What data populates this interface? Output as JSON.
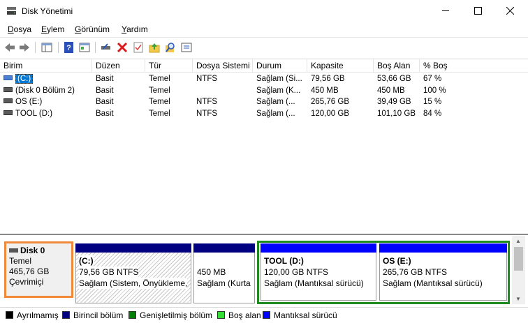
{
  "window": {
    "title": "Disk Yönetimi"
  },
  "menu": [
    {
      "key": "D",
      "rest": "osya"
    },
    {
      "key": "E",
      "rest": "ylem"
    },
    {
      "key": "G",
      "rest": "örünüm"
    },
    {
      "key": "Y",
      "rest": "ardım"
    }
  ],
  "columns": [
    "Birim",
    "Düzen",
    "Tür",
    "Dosya Sistemi",
    "Durum",
    "Kapasite",
    "Boş Alan",
    "% Boş"
  ],
  "volumes": [
    {
      "name": "(C:)",
      "layout": "Basit",
      "type": "Temel",
      "fs": "NTFS",
      "status": "Sağlam (Si...",
      "capacity": "79,56 GB",
      "free": "53,66 GB",
      "pct": "67 %",
      "icon": "volume-blue-icon"
    },
    {
      "name": "(Disk 0 Bölüm 2)",
      "layout": "Basit",
      "type": "Temel",
      "fs": "",
      "status": "Sağlam (K...",
      "capacity": "450 MB",
      "free": "450 MB",
      "pct": "100 %",
      "icon": "volume-icon"
    },
    {
      "name": "OS (E:)",
      "layout": "Basit",
      "type": "Temel",
      "fs": "NTFS",
      "status": "Sağlam (...",
      "capacity": "265,76 GB",
      "free": "39,49 GB",
      "pct": "15 %",
      "icon": "volume-icon"
    },
    {
      "name": "TOOL (D:)",
      "layout": "Basit",
      "type": "Temel",
      "fs": "NTFS",
      "status": "Sağlam (...",
      "capacity": "120,00 GB",
      "free": "101,10 GB",
      "pct": "84 %",
      "icon": "volume-icon"
    }
  ],
  "disk": {
    "name": "Disk 0",
    "type": "Temel",
    "size": "465,76 GB",
    "state": "Çevrimiçi"
  },
  "partitions": [
    {
      "label": "(C:)",
      "size": "79,56 GB NTFS",
      "status": "Sağlam (Sistem, Önyükleme,"
    },
    {
      "label": "",
      "size": "450 MB",
      "status": "Sağlam (Kurta"
    },
    {
      "label": "TOOL  (D:)",
      "size": "120,00 GB NTFS",
      "status": "Sağlam (Mantıksal sürücü)"
    },
    {
      "label": "OS  (E:)",
      "size": "265,76 GB NTFS",
      "status": "Sağlam (Mantıksal sürücü)"
    }
  ],
  "legend": [
    {
      "label": "Ayrılmamış",
      "color": "#000000"
    },
    {
      "label": "Birincil bölüm",
      "color": "#000080"
    },
    {
      "label": "Genişletilmiş bölüm",
      "color": "#008000"
    },
    {
      "label": "Boş alan",
      "color": "#33dd33"
    },
    {
      "label": "Mantıksal sürücü",
      "color": "#0000ff"
    }
  ],
  "colors": {
    "primary_bar": "#000080",
    "logical_bar": "#0000ff",
    "extended_frame": "#1f8a1f",
    "selection": "#0078d7",
    "disk_highlight": "#f08a3a"
  }
}
